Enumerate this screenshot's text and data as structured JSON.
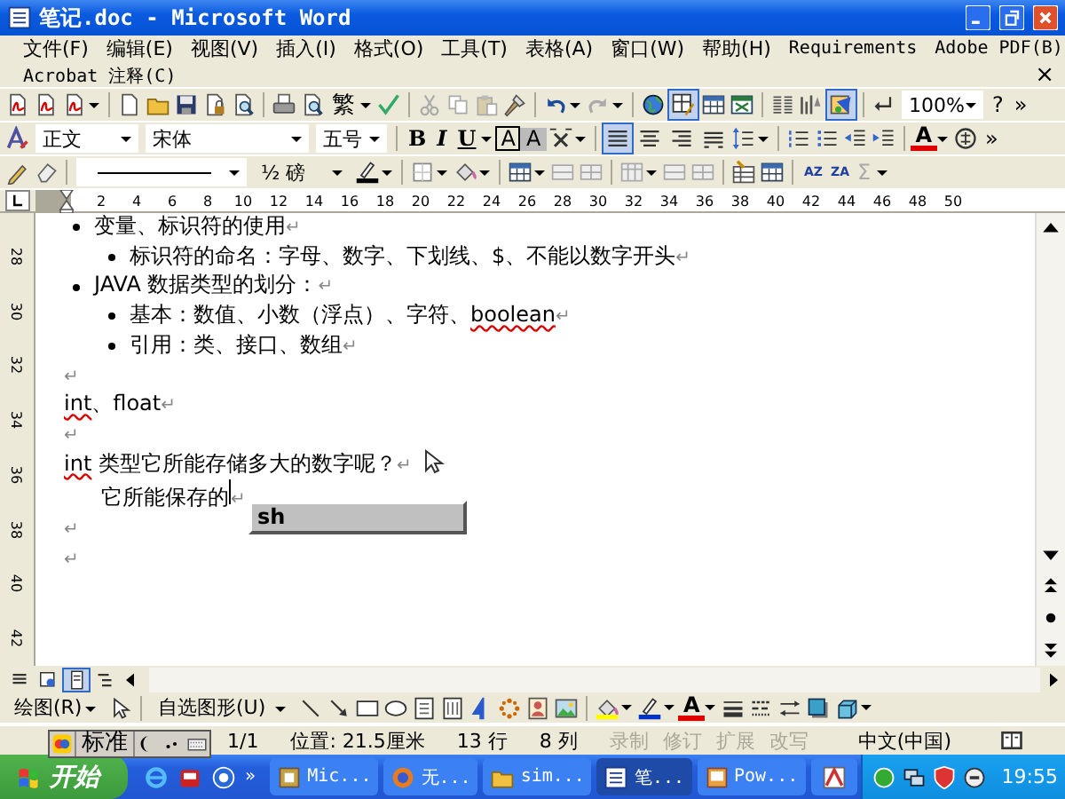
{
  "window": {
    "title": "笔记.doc - Microsoft Word"
  },
  "menu_bar": {
    "items": [
      "文件(F)",
      "编辑(E)",
      "视图(V)",
      "插入(I)",
      "格式(O)",
      "工具(T)",
      "表格(A)",
      "窗口(W)",
      "帮助(H)",
      "Requirements",
      "Adobe PDF(B)"
    ],
    "second_row": [
      "Acrobat 注释(C)"
    ],
    "close_document": "×"
  },
  "standard_toolbar": {
    "conversion": "繁",
    "tables_borders_on": true,
    "document_map_on": true,
    "zoom": "100%",
    "help": "?",
    "more": "»"
  },
  "formatting_toolbar": {
    "style": "正文",
    "font": "宋体",
    "size": "五号",
    "bold": "B",
    "italic": "I",
    "underline": "U",
    "char_border": "A",
    "char_shading": "A",
    "alignment": [
      {
        "selected": true
      },
      {
        "selected": false
      },
      {
        "selected": false
      },
      {
        "selected": false
      }
    ],
    "font_color": "A",
    "more": "»"
  },
  "tables_toolbar": {
    "line_weight": "½ 磅",
    "sort_ascending": "AZ",
    "sort_descending": "ZA",
    "sum": "Σ"
  },
  "ruler": {
    "horizontal": [
      "2",
      "4",
      "6",
      "8",
      "10",
      "12",
      "14",
      "16",
      "18",
      "20",
      "22",
      "24",
      "26",
      "28",
      "30",
      "32",
      "34",
      "36",
      "38",
      "40",
      "42",
      "44",
      "46",
      "48",
      "50"
    ],
    "vertical": [
      "28",
      "30",
      "32",
      "34",
      "36",
      "38",
      "40",
      "42"
    ]
  },
  "document": {
    "blocks": [
      {
        "kind": "list",
        "items": [
          {
            "text": "变量、标识符的使用",
            "mark": "↵",
            "children": [
              {
                "text": "标识符的命名：字母、数字、下划线、$、不能以数字开头",
                "mark": "↵"
              }
            ]
          },
          {
            "text": "JAVA 数据类型的划分：",
            "mark": "↵",
            "children": [
              {
                "segments": [
                  {
                    "text": "基本：数值、小数（浮点）、字符、",
                    "misspelled": false
                  },
                  {
                    "text": "boolean",
                    "misspelled": true
                  }
                ],
                "mark": "↵"
              },
              {
                "text": "引用：类、接口、数组",
                "mark": "↵"
              }
            ]
          }
        ]
      },
      {
        "kind": "para",
        "mark": "↵"
      },
      {
        "kind": "para",
        "segments": [
          {
            "text": "int",
            "misspelled": true
          },
          {
            "text": "、float",
            "misspelled": false
          }
        ],
        "mark": "↵"
      },
      {
        "kind": "para",
        "mark": "↵"
      },
      {
        "kind": "para",
        "segments": [
          {
            "text": "int",
            "misspelled": true
          },
          {
            "text": " 类型它所能存储多大的数字呢？",
            "misspelled": false
          }
        ],
        "mark": "↵"
      },
      {
        "kind": "para",
        "text": "它所能保存的",
        "first_line_indent": true,
        "cursor": true,
        "mark": "↵"
      },
      {
        "kind": "para",
        "mark": "↵"
      },
      {
        "kind": "para",
        "mark": "↵"
      }
    ]
  },
  "ime_composition": "sh",
  "view_buttons": [
    {
      "selected": false
    },
    {
      "selected": false
    },
    {
      "selected": true
    },
    {
      "selected": false
    }
  ],
  "drawing_toolbar": {
    "draw_menu": "绘图(R)",
    "autoshapes_menu": "自选图形(U)",
    "font_color": "A"
  },
  "ime_bar": {
    "mode": "标准"
  },
  "status_bar": {
    "page": "1/1",
    "position": "位置: 21.5厘米",
    "line": "13 行",
    "column": "8 列",
    "modes": [
      {
        "label": "录制",
        "disabled": true
      },
      {
        "label": "修订",
        "disabled": true
      },
      {
        "label": "扩展",
        "disabled": true
      },
      {
        "label": "改写",
        "disabled": true
      }
    ],
    "language": "中文(中国)"
  },
  "taskbar": {
    "start": "开始",
    "more": "»",
    "tasks": [
      {
        "label": "Mic...",
        "selected": false
      },
      {
        "label": "无...",
        "selected": false
      },
      {
        "label": "sim...",
        "selected": false
      },
      {
        "label": "笔...",
        "selected": true
      },
      {
        "label": "Pow...",
        "selected": false
      }
    ],
    "clock": "19:55"
  }
}
